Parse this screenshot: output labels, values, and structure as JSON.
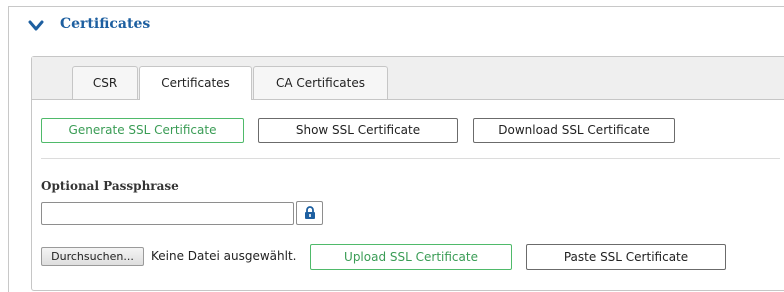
{
  "section": {
    "title": "Certificates"
  },
  "tabs": [
    {
      "label": "CSR",
      "active": false
    },
    {
      "label": "Certificates",
      "active": true
    },
    {
      "label": "CA Certificates",
      "active": false
    }
  ],
  "actions": {
    "generate_label": "Generate SSL Certificate",
    "show_label": "Show SSL Certificate",
    "download_label": "Download SSL Certificate"
  },
  "passphrase": {
    "label": "Optional Passphrase",
    "value": ""
  },
  "file": {
    "browse_label": "Durchsuchen...",
    "status_text": "Keine Datei ausgewählt."
  },
  "upload": {
    "upload_label": "Upload SSL Certificate",
    "paste_label": "Paste SSL Certificate"
  },
  "colors": {
    "title_blue": "#1d5fa0",
    "accent_green": "#4fba6a",
    "tab_strip_bg": "#efefef"
  },
  "icons": {
    "section_toggle": "chevron-down-icon",
    "passphrase_toggle": "lock-icon"
  }
}
